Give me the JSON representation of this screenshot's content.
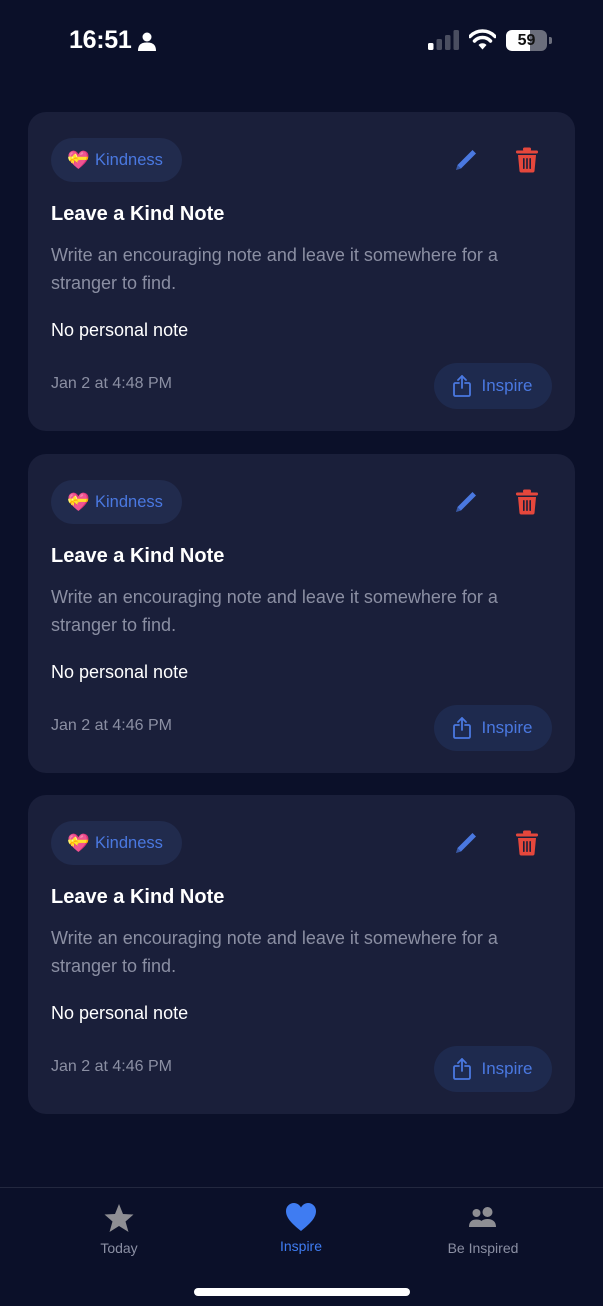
{
  "status_bar": {
    "time": "16:51",
    "battery_level": "59",
    "battery_fraction": 0.59,
    "signal_bars_active": 1,
    "signal_bars_total": 4
  },
  "colors": {
    "background": "#0b1029",
    "card": "#1a1f3a",
    "accent": "#4a78e0",
    "tab_active": "#3f7cf2",
    "delete": "#e5473c",
    "muted_text": "#8b8fa3"
  },
  "cards": [
    {
      "tag_emoji": "💝",
      "tag_label": "Kindness",
      "title": "Leave a Kind Note",
      "description": "Write an encouraging note and leave it somewhere for a stranger to find.",
      "note": "No personal note",
      "date": "Jan 2 at 4:48 PM",
      "edit_icon": "pencil-icon",
      "delete_icon": "trash-icon",
      "action_icon": "share-icon",
      "action_label": "Inspire"
    },
    {
      "tag_emoji": "💝",
      "tag_label": "Kindness",
      "title": "Leave a Kind Note",
      "description": "Write an encouraging note and leave it somewhere for a stranger to find.",
      "note": "No personal note",
      "date": "Jan 2 at 4:46 PM",
      "edit_icon": "pencil-icon",
      "delete_icon": "trash-icon",
      "action_icon": "share-icon",
      "action_label": "Inspire"
    },
    {
      "tag_emoji": "💝",
      "tag_label": "Kindness",
      "title": "Leave a Kind Note",
      "description": "Write an encouraging note and leave it somewhere for a stranger to find.",
      "note": "No personal note",
      "date": "Jan 2 at 4:46 PM",
      "edit_icon": "pencil-icon",
      "delete_icon": "trash-icon",
      "action_icon": "share-icon",
      "action_label": "Inspire"
    }
  ],
  "tab_bar": {
    "tabs": [
      {
        "label": "Today",
        "icon": "star-icon",
        "active": false
      },
      {
        "label": "Inspire",
        "icon": "heart-icon",
        "active": true
      },
      {
        "label": "Be Inspired",
        "icon": "people-icon",
        "active": false
      }
    ]
  }
}
